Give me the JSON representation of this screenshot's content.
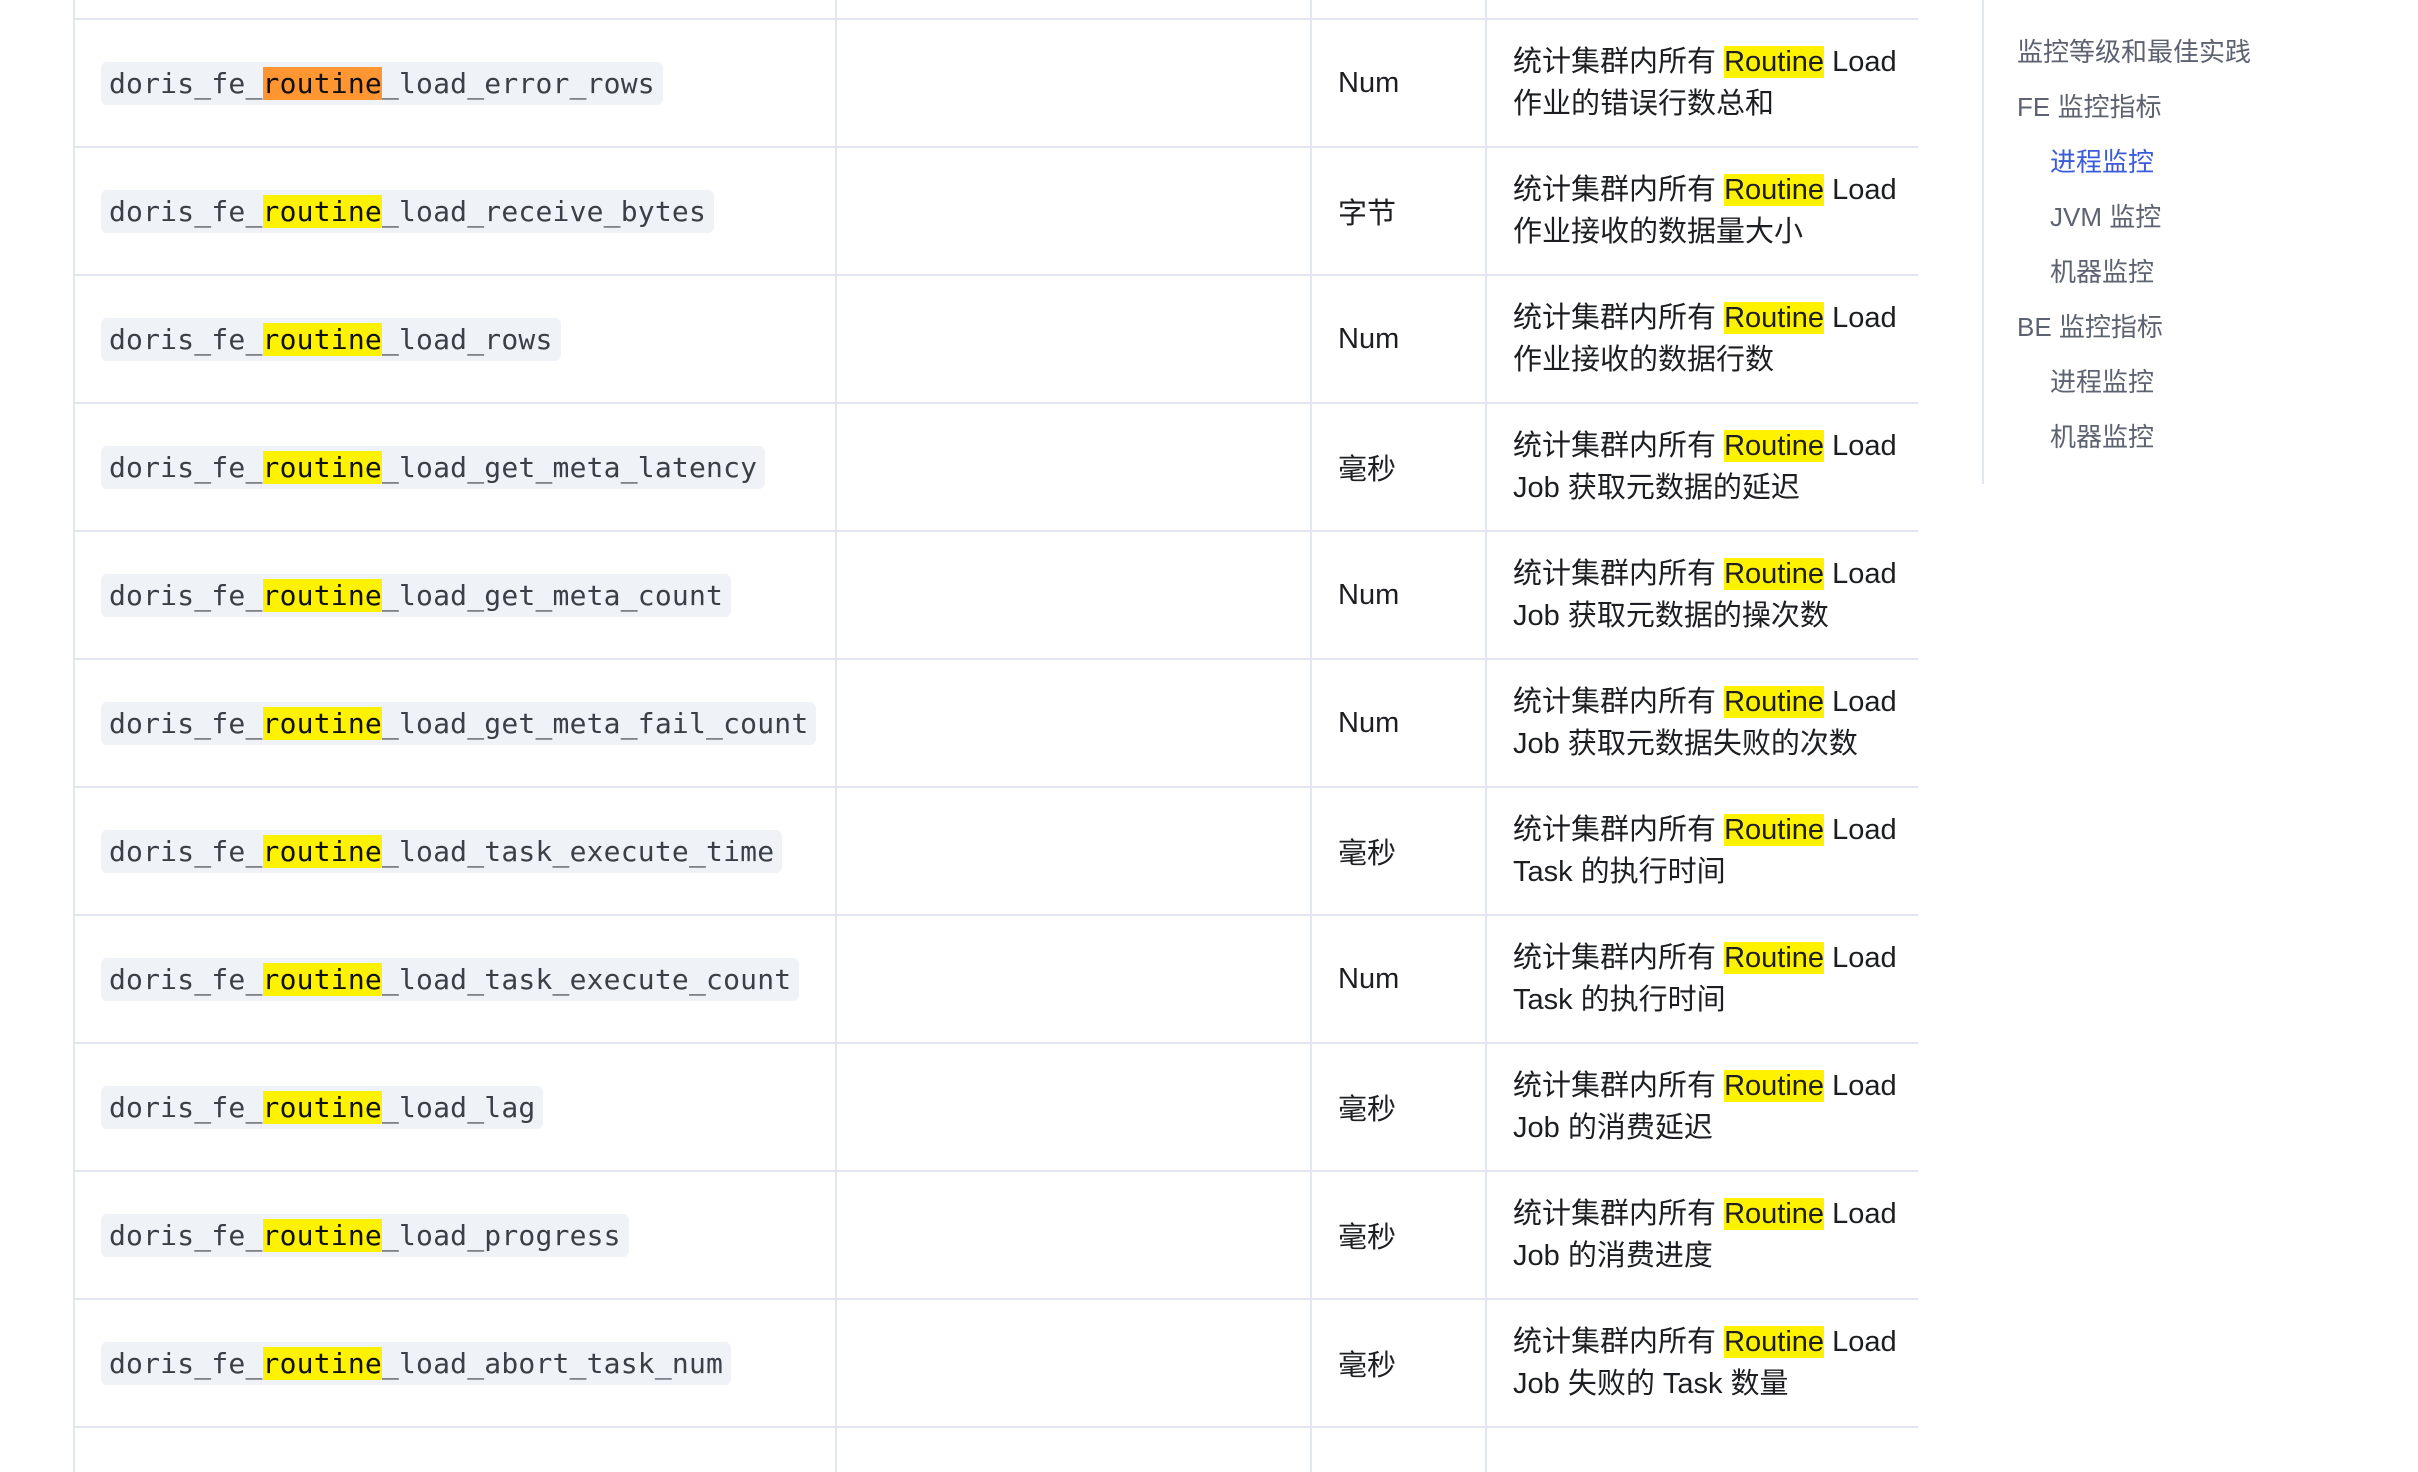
{
  "rows": [
    {
      "name_prefix": "doris_fe_",
      "name_hl": "routine",
      "name_suffix": "_load_error_rows",
      "active": true,
      "unit": "Num",
      "desc_pre": "统计集群内所有 ",
      "desc_hl": "Routine",
      "desc_mid": " Load",
      "desc_line2": "作业的错误行数总和"
    },
    {
      "name_prefix": "doris_fe_",
      "name_hl": "routine",
      "name_suffix": "_load_receive_bytes",
      "active": false,
      "unit": "字节",
      "desc_pre": "统计集群内所有 ",
      "desc_hl": "Routine",
      "desc_mid": " Load",
      "desc_line2": "作业接收的数据量大小"
    },
    {
      "name_prefix": "doris_fe_",
      "name_hl": "routine",
      "name_suffix": "_load_rows",
      "active": false,
      "unit": "Num",
      "desc_pre": "统计集群内所有 ",
      "desc_hl": "Routine",
      "desc_mid": " Load",
      "desc_line2": "作业接收的数据行数"
    },
    {
      "name_prefix": "doris_fe_",
      "name_hl": "routine",
      "name_suffix": "_load_get_meta_latency",
      "active": false,
      "unit": "毫秒",
      "desc_pre": "统计集群内所有 ",
      "desc_hl": "Routine",
      "desc_mid": " Load",
      "desc_line2": "Job 获取元数据的延迟"
    },
    {
      "name_prefix": "doris_fe_",
      "name_hl": "routine",
      "name_suffix": "_load_get_meta_count",
      "active": false,
      "unit": "Num",
      "desc_pre": "统计集群内所有 ",
      "desc_hl": "Routine",
      "desc_mid": " Load",
      "desc_line2": "Job 获取元数据的操次数"
    },
    {
      "name_prefix": "doris_fe_",
      "name_hl": "routine",
      "name_suffix": "_load_get_meta_fail_count",
      "active": false,
      "unit": "Num",
      "desc_pre": "统计集群内所有 ",
      "desc_hl": "Routine",
      "desc_mid": " Load",
      "desc_line2": "Job 获取元数据失败的次数"
    },
    {
      "name_prefix": "doris_fe_",
      "name_hl": "routine",
      "name_suffix": "_load_task_execute_time",
      "active": false,
      "unit": "毫秒",
      "desc_pre": "统计集群内所有 ",
      "desc_hl": "Routine",
      "desc_mid": " Load",
      "desc_line2": "Task 的执行时间"
    },
    {
      "name_prefix": "doris_fe_",
      "name_hl": "routine",
      "name_suffix": "_load_task_execute_count",
      "active": false,
      "unit": "Num",
      "desc_pre": "统计集群内所有 ",
      "desc_hl": "Routine",
      "desc_mid": " Load",
      "desc_line2": "Task 的执行时间"
    },
    {
      "name_prefix": "doris_fe_",
      "name_hl": "routine",
      "name_suffix": "_load_lag",
      "active": false,
      "unit": "毫秒",
      "desc_pre": "统计集群内所有 ",
      "desc_hl": "Routine",
      "desc_mid": " Load",
      "desc_line2": "Job 的消费延迟"
    },
    {
      "name_prefix": "doris_fe_",
      "name_hl": "routine",
      "name_suffix": "_load_progress",
      "active": false,
      "unit": "毫秒",
      "desc_pre": "统计集群内所有 ",
      "desc_hl": "Routine",
      "desc_mid": " Load",
      "desc_line2": "Job 的消费进度"
    },
    {
      "name_prefix": "doris_fe_",
      "name_hl": "routine",
      "name_suffix": "_load_abort_task_num",
      "active": false,
      "unit": "毫秒",
      "desc_pre": "统计集群内所有 ",
      "desc_hl": "Routine",
      "desc_mid": " Load",
      "desc_line2": "Job 失败的 Task 数量"
    }
  ],
  "toc": {
    "items": [
      {
        "label": "监控等级和最佳实践",
        "level": 1,
        "active": false
      },
      {
        "label": "FE 监控指标",
        "level": 1,
        "active": false
      },
      {
        "label": "进程监控",
        "level": 2,
        "active": true
      },
      {
        "label": "JVM 监控",
        "level": 2,
        "active": false
      },
      {
        "label": "机器监控",
        "level": 2,
        "active": false
      },
      {
        "label": "BE 监控指标",
        "level": 1,
        "active": false
      },
      {
        "label": "进程监控",
        "level": 2,
        "active": false
      },
      {
        "label": "机器监控",
        "level": 2,
        "active": false
      }
    ]
  },
  "colors": {
    "highlight": "#fff200",
    "highlight_active": "#ff9632",
    "toc_active": "#3b5bdb",
    "border": "#e3e7ef",
    "code_bg": "#eff2f7"
  }
}
